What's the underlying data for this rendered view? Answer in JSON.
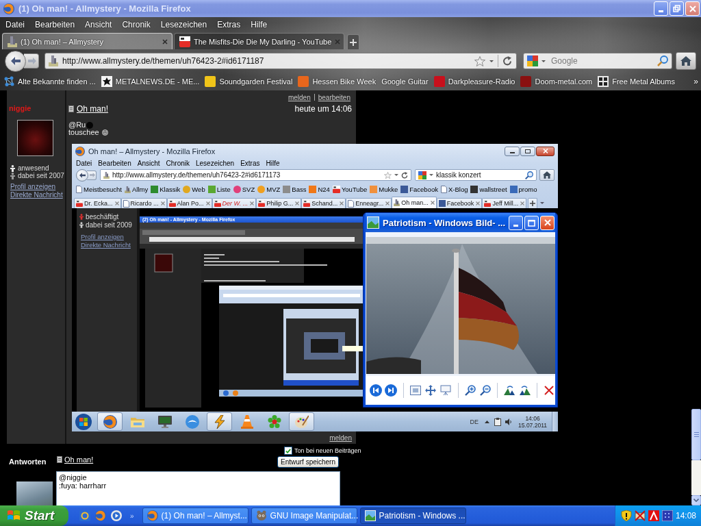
{
  "window": {
    "title": "(1) Oh man! - Allmystery - Mozilla Firefox",
    "active": false
  },
  "menu": [
    "Datei",
    "Bearbeiten",
    "Ansicht",
    "Chronik",
    "Lesezeichen",
    "Extras",
    "Hilfe"
  ],
  "tabs": [
    {
      "label": "(1) Oh man! – Allmystery",
      "kind": "site",
      "selected": true
    },
    {
      "label": "The Misfits-Die Die My Darling - YouTube",
      "kind": "video",
      "selected": false
    }
  ],
  "forward_button": {
    "disabled": true
  },
  "address_bar": {
    "url": "http://www.allmystery.de/themen/uh76423-2#id6171187"
  },
  "search_field": {
    "placeholder": "Google"
  },
  "bookmarks": {
    "items": [
      {
        "label": "Alte Bekannte finden ...",
        "kind": "network"
      },
      {
        "label": "METALNEWS.DE - ME...",
        "kind": "splat"
      },
      {
        "label": "Soundgarden Festival",
        "kind": "tile",
        "color": "#f0c419"
      },
      {
        "label": "Hessen Bike Week",
        "kind": "tile",
        "color": "#e8661c"
      },
      {
        "label": "Google Guitar",
        "kind": "none"
      },
      {
        "label": "Darkpleasure-Radio",
        "kind": "tile",
        "color": "#c8101c"
      },
      {
        "label": "Doom-metal.com",
        "kind": "tile",
        "color": "#8a1010"
      },
      {
        "label": "Free Metal Albums",
        "kind": "grid"
      }
    ],
    "overflow": "»"
  },
  "post": {
    "actions": [
      "melden",
      "bearbeiten"
    ],
    "author": {
      "name": "niggie",
      "busy": false,
      "status": "anwesend",
      "since": "dabei seit 2007",
      "links": [
        "Profil anzeigen",
        "Direkte Nachricht"
      ]
    },
    "title": "Oh man!",
    "time": "heute um 14:06",
    "lines": [
      {
        "text": "@Ru",
        "kind": "blot"
      },
      {
        "text": "touschee",
        "kind": "smiley"
      }
    ],
    "screenshot": {
      "window": {
        "title": "Oh man! – Allmystery - Mozilla Firefox"
      },
      "menu": [
        "Datei",
        "Bearbeiten",
        "Ansicht",
        "Chronik",
        "Lesezeichen",
        "Extras",
        "Hilfe"
      ],
      "forward_button": {
        "disabled": true
      },
      "address_bar": {
        "url": "http://www.allmystery.de/themen/uh76423-2#id6171173"
      },
      "search_field": {
        "value": "klassik konzert"
      },
      "bookmarks": [
        {
          "label": "Meistbesucht",
          "kind": "page"
        },
        {
          "label": "Allmy",
          "kind": "bars"
        },
        {
          "label": "Klassik",
          "kind": "tile",
          "color": "#2e8b2e"
        },
        {
          "label": "Web",
          "kind": "circle",
          "color": "#e0a820"
        },
        {
          "label": "Liste",
          "kind": "tile",
          "color": "#5aa832"
        },
        {
          "label": "SVZ",
          "kind": "circle",
          "color": "#e0407a"
        },
        {
          "label": "MVZ",
          "kind": "circle",
          "color": "#f0a020"
        },
        {
          "label": "Bass",
          "kind": "tile",
          "color": "#8c8c8c"
        },
        {
          "label": "N24",
          "kind": "tile",
          "color": "#f07818"
        },
        {
          "label": "YouTube",
          "kind": "video"
        },
        {
          "label": "Mukke",
          "kind": "tile",
          "color": "#f0903c"
        },
        {
          "label": "Facebook",
          "kind": "tile",
          "color": "#3b5998"
        },
        {
          "label": "X-Blog",
          "kind": "page"
        },
        {
          "label": "wallstreet",
          "kind": "tile",
          "color": "#333333"
        },
        {
          "label": "promo",
          "kind": "tile",
          "color": "#3a6ab8"
        }
      ],
      "tabs": [
        {
          "label": "Dr. Ecka...",
          "kind": "video",
          "selected": false,
          "highlighted": false
        },
        {
          "label": "Ricardo ...",
          "kind": "page",
          "selected": false,
          "highlighted": false
        },
        {
          "label": "Alan Po...",
          "kind": "video",
          "selected": false,
          "highlighted": false
        },
        {
          "label": "Der W. ...",
          "kind": "video",
          "selected": false,
          "highlighted": true
        },
        {
          "label": "Philip G...",
          "kind": "video",
          "selected": false,
          "highlighted": false
        },
        {
          "label": "Schand...",
          "kind": "video",
          "selected": false,
          "highlighted": false
        },
        {
          "label": "Enneagr...",
          "kind": "page",
          "selected": false,
          "highlighted": false
        },
        {
          "label": "Oh man...",
          "kind": "site",
          "selected": true,
          "highlighted": false
        },
        {
          "label": "Facebook",
          "kind": "tile",
          "color": "#3b5998",
          "selected": false,
          "highlighted": false
        },
        {
          "label": "Jeff Mill...",
          "kind": "video",
          "selected": false,
          "highlighted": false
        }
      ],
      "profile": {
        "busy": true,
        "status": "beschäftigt",
        "since": "dabei seit 2009",
        "links": [
          "Profil anzeigen",
          "Direkte Nachricht"
        ]
      },
      "nested_window": {
        "title": "(2) Oh man! - Allmystery - Mozilla Firefox"
      },
      "taskbar": {
        "apps": [
          {
            "kind": "firefox",
            "running": true
          },
          {
            "kind": "folder",
            "running": false
          },
          {
            "kind": "monitor",
            "running": false
          },
          {
            "kind": "bird",
            "running": false
          },
          {
            "kind": "bolt",
            "running": true
          },
          {
            "kind": "cone",
            "running": false
          },
          {
            "kind": "flower",
            "running": false
          },
          {
            "kind": "palette",
            "running": true
          }
        ],
        "language": "DE",
        "time": "14:06",
        "date": "15.07.2011"
      }
    },
    "bottom_action": "melden"
  },
  "viewer": {
    "title": "Patriotism - Windows Bild- ...",
    "active": true
  },
  "reply": {
    "heading": "Antworten",
    "topic": "Oh man!",
    "sound_option": {
      "label": "Ton bei neuen Beiträgen",
      "checked": true
    },
    "save_button": "Entwurf speichern",
    "message": "@niggie\n:fuya: harrharr"
  },
  "taskbar": {
    "start": "Start",
    "overflow": "»",
    "tasks": [
      {
        "label": "(1) Oh man! – Allmyst...",
        "kind": "firefox",
        "selected": false
      },
      {
        "label": "GNU Image Manipulat...",
        "kind": "creature",
        "selected": false
      },
      {
        "label": "Patriotism - Windows ...",
        "kind": "landscape",
        "selected": true
      }
    ],
    "clock": "14:08"
  }
}
